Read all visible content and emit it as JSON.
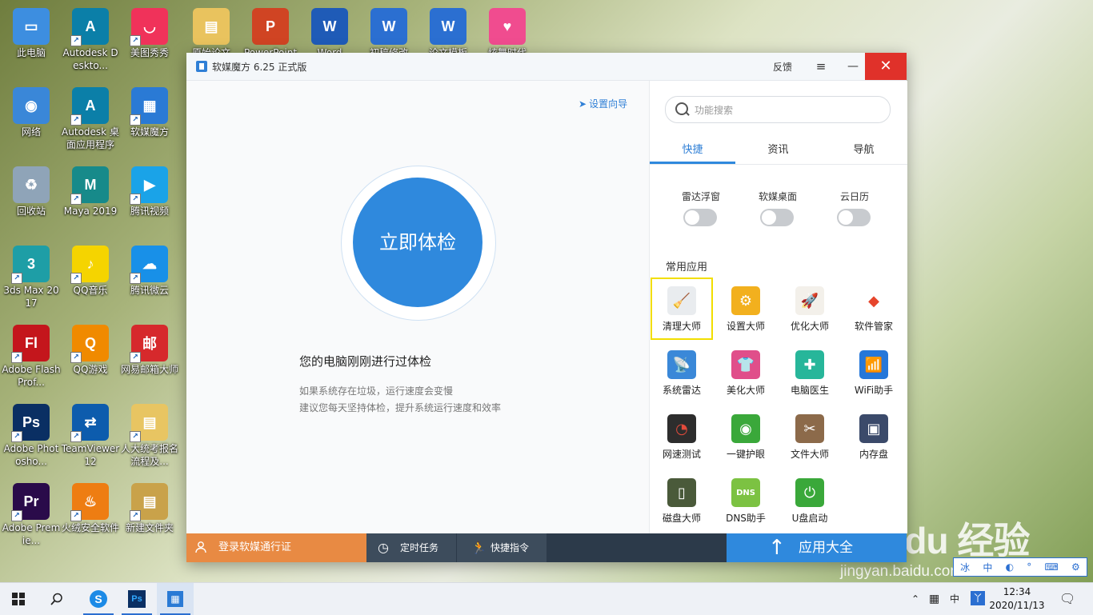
{
  "desktop": {
    "items": [
      {
        "label": "此电脑",
        "color": "#3d8ee0",
        "glyph": "▭"
      },
      {
        "label": "网络",
        "color": "#3a87d8",
        "glyph": "◉"
      },
      {
        "label": "回收站",
        "color": "#8fa4b8",
        "glyph": "♻"
      },
      {
        "label": "3ds Max 2017",
        "color": "#1e9ea6",
        "glyph": "3"
      },
      {
        "label": "Adobe Flash Prof...",
        "color": "#c4161c",
        "glyph": "Fl"
      },
      {
        "label": "Adobe Photosho...",
        "color": "#0a2f63",
        "glyph": "Ps"
      },
      {
        "label": "Adobe Premie...",
        "color": "#2a0b4a",
        "glyph": "Pr"
      },
      {
        "label": "Autodesk Deskto...",
        "color": "#0b7fa8",
        "glyph": "A"
      },
      {
        "label": "Autodesk 桌面应用程序",
        "color": "#0b7fa8",
        "glyph": "A"
      },
      {
        "label": "Maya 2019",
        "color": "#178a8a",
        "glyph": "M"
      },
      {
        "label": "QQ音乐",
        "color": "#f5d400",
        "glyph": "♪"
      },
      {
        "label": "QQ游戏",
        "color": "#f08a00",
        "glyph": "Q"
      },
      {
        "label": "TeamViewer 12",
        "color": "#0d5cad",
        "glyph": "⇄"
      },
      {
        "label": "火绒安全软件",
        "color": "#ee7d12",
        "glyph": "♨"
      },
      {
        "label": "美图秀秀",
        "color": "#f0325a",
        "glyph": "◡"
      },
      {
        "label": "软媒魔方",
        "color": "#2a7ad5",
        "glyph": "▦"
      },
      {
        "label": "腾讯视频",
        "color": "#1aa3e8",
        "glyph": "▶"
      },
      {
        "label": "腾讯微云",
        "color": "#1890e8",
        "glyph": "☁"
      },
      {
        "label": "网易邮箱大师",
        "color": "#d6292c",
        "glyph": "邮"
      },
      {
        "label": "人大统考报名流程及...",
        "color": "#e8c562",
        "glyph": "▤"
      },
      {
        "label": "新建文件夹",
        "color": "#c9a24a",
        "glyph": "▤"
      }
    ],
    "top_row_partial": [
      {
        "label": "原始论文",
        "color": "#e9c35e",
        "glyph": "▤"
      },
      {
        "label": "PowerPoint",
        "color": "#d04423",
        "glyph": "P"
      },
      {
        "label": "Word",
        "color": "#1f5bb7",
        "glyph": "W"
      },
      {
        "label": "初稿修改",
        "color": "#2b6fd1",
        "glyph": "W"
      },
      {
        "label": "论文模板",
        "color": "#2b6fd1",
        "glyph": "W"
      },
      {
        "label": "炫舞时代",
        "color": "#f04c8f",
        "glyph": "♥"
      }
    ]
  },
  "window": {
    "title": "软媒魔方 6.25 正式版",
    "feedback": "反馈",
    "menu_icon": "≡",
    "min_icon": "—",
    "close_icon": "✕"
  },
  "left": {
    "wizard": "设置向导",
    "check_button": "立即体检",
    "status": "您的电脑刚刚进行过体检",
    "hint1": "如果系统存在垃圾，运行速度会变慢",
    "hint2": "建议您每天坚持体检，提升系统运行速度和效率"
  },
  "right": {
    "search_placeholder": "功能搜索",
    "tabs": [
      "快捷",
      "资讯",
      "导航"
    ],
    "toggles": [
      {
        "label": "雷达浮窗",
        "on": false
      },
      {
        "label": "软媒桌面",
        "on": false
      },
      {
        "label": "云日历",
        "on": false
      }
    ],
    "section_title": "常用应用",
    "apps": [
      {
        "label": "清理大师",
        "color": "#e9ecef",
        "glyph": "🧹",
        "fg": "#6a9a2a",
        "selected": true
      },
      {
        "label": "设置大师",
        "color": "#f2b01e",
        "glyph": "⚙",
        "fg": "#ffffff"
      },
      {
        "label": "优化大师",
        "color": "#f3f0ea",
        "glyph": "🚀",
        "fg": "#e24a3b"
      },
      {
        "label": "软件管家",
        "color": "#ffffff",
        "glyph": "◆",
        "fg": "#e6452c"
      },
      {
        "label": "系统雷达",
        "color": "#3a88d8",
        "glyph": "📡",
        "fg": "#ffffff"
      },
      {
        "label": "美化大师",
        "color": "#e04e8a",
        "glyph": "👕",
        "fg": "#ffffff"
      },
      {
        "label": "电脑医生",
        "color": "#27b69a",
        "glyph": "✚",
        "fg": "#ffffff"
      },
      {
        "label": "WiFi助手",
        "color": "#2577d9",
        "glyph": "📶",
        "fg": "#ffffff"
      },
      {
        "label": "网速测试",
        "color": "#2d2d2d",
        "glyph": "◔",
        "fg": "#e24a3b"
      },
      {
        "label": "一键护眼",
        "color": "#3aa83a",
        "glyph": "◉",
        "fg": "#ffffff"
      },
      {
        "label": "文件大师",
        "color": "#8c6a4a",
        "glyph": "✂",
        "fg": "#ffffff"
      },
      {
        "label": "内存盘",
        "color": "#3b4a6a",
        "glyph": "▣",
        "fg": "#ffffff"
      },
      {
        "label": "磁盘大师",
        "color": "#4a5a3a",
        "glyph": "▯",
        "fg": "#ffffff"
      },
      {
        "label": "DNS助手",
        "color": "#7cc242",
        "glyph": "DNS",
        "fg": "#ffffff"
      },
      {
        "label": "U盘启动",
        "color": "#3aa83a",
        "glyph": "⏻",
        "fg": "#ffffff"
      }
    ]
  },
  "bottom": {
    "login": "登录软媒通行证",
    "timer": "定时任务",
    "shortcut": "快捷指令",
    "appstore": "应用大全"
  },
  "watermark": {
    "brand": "Bai du 经验",
    "url": "jingyan.baidu.com"
  },
  "ime": [
    "冰",
    "中",
    "◐",
    "°",
    "⌨",
    "⚙"
  ],
  "taskbar": {
    "tray_ime": "中",
    "tray_ime2": "丫",
    "time": "12:34",
    "date": "2020/11/13"
  }
}
